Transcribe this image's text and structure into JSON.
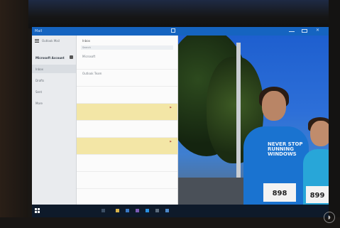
{
  "window": {
    "title": "Mail"
  },
  "folder_pane": {
    "header": "Outlook Mail",
    "account": "Microsoft Account",
    "items": [
      {
        "label": "Inbox",
        "selected": true
      },
      {
        "label": "Drafts",
        "selected": false
      },
      {
        "label": "Sent",
        "selected": false
      },
      {
        "label": "More",
        "selected": false
      }
    ]
  },
  "message_pane": {
    "title": "Inbox",
    "search_placeholder": "Search",
    "messages": [
      {
        "sender": "Microsoft",
        "preview": "",
        "date": "",
        "flagged": false
      },
      {
        "sender": "Outlook Team",
        "preview": "",
        "date": "",
        "flagged": false
      },
      {
        "sender": "",
        "preview": "",
        "date": "",
        "flagged": false
      },
      {
        "sender": "",
        "preview": "",
        "date": "",
        "flagged": true
      },
      {
        "sender": "",
        "preview": "",
        "date": "",
        "flagged": false
      },
      {
        "sender": "",
        "preview": "",
        "date": "",
        "flagged": true
      },
      {
        "sender": "",
        "preview": "",
        "date": "",
        "flagged": false
      },
      {
        "sender": "",
        "preview": "",
        "date": "",
        "flagged": false
      },
      {
        "sender": "",
        "preview": "",
        "date": "",
        "flagged": false
      }
    ]
  },
  "photo": {
    "shirt_text": "NEVER STOP RUNNING WINDOWS",
    "bib_left": "898",
    "bib_right": "899"
  },
  "colors": {
    "accent": "#1564c0",
    "flag": "#f3e6a6",
    "taskbar": "#0e1a2a"
  }
}
